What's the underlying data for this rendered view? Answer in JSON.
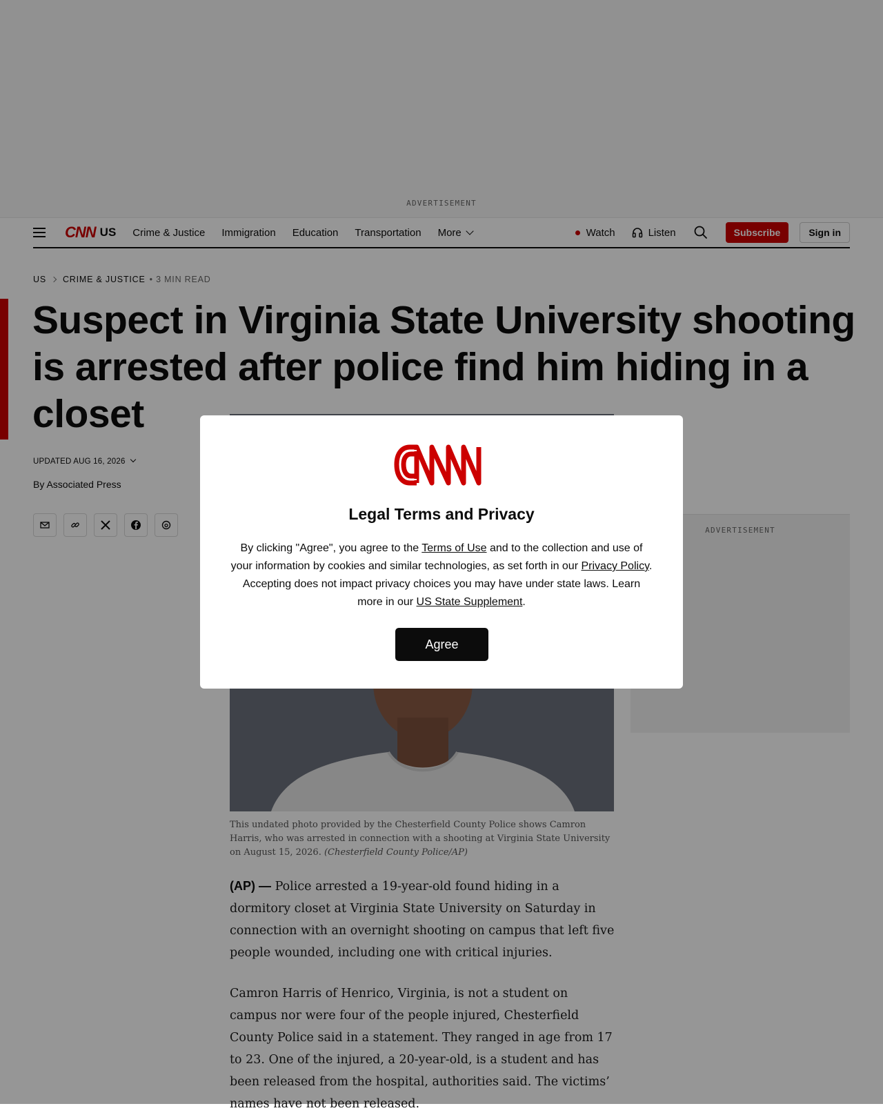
{
  "advertisement": {
    "top_label": "ADVERTISEMENT",
    "side_label": "ADVERTISEMENT"
  },
  "nav": {
    "logo": "CNN",
    "edition": "US",
    "items": [
      "Crime & Justice",
      "Immigration",
      "Education",
      "Transportation",
      "More"
    ],
    "watch": "Watch",
    "listen": "Listen",
    "subscribe": "Subscribe",
    "signin": "Sign in"
  },
  "breadcrumb": {
    "section": "US",
    "subsection": "CRIME & JUSTICE",
    "read_time": "• 3 MIN READ"
  },
  "article": {
    "headline": "Suspect in Virginia State University shooting is arrested after police find him hiding in a closet",
    "updated": "UPDATED AUG 16, 2026",
    "byline": "By Associated Press",
    "caption_text": "This undated photo provided by the Chesterfield County Police shows Camron Harris, who was arrested in connection with a shooting at Virginia State University on August 15, 2026.",
    "caption_credit": "(Chesterfield County Police/AP)",
    "dateline": "(AP) —",
    "p1": "Police arrested a 19-year-old found hiding in a dormitory closet at Virginia State University on Saturday in connection with an overnight shooting on campus that left five people wounded, including one with critical injuries.",
    "p2": "Camron Harris of Henrico, Virginia, is not a student on campus nor were four of the people injured, Chesterfield County Police said in a statement. They ranged in age from 17 to 23. One of the injured, a 20-year-old, is a student and has been released from the hospital, authorities said. The victims’ names have not been released."
  },
  "share": {
    "icons": [
      "email-icon",
      "link-icon",
      "x-icon",
      "facebook-icon",
      "threads-icon"
    ]
  },
  "modal": {
    "logo": "CNN",
    "title": "Legal Terms and Privacy",
    "text_1": "By clicking \"Agree\", you agree to the ",
    "link_terms": "Terms of Use",
    "text_2": " and to the collection and use of your information by cookies and similar technologies, as set forth in our ",
    "link_privacy": "Privacy Policy",
    "text_3": ". Accepting does not impact privacy choices you may have under state laws. Learn more in our ",
    "link_supplement": "US State Supplement",
    "text_4": ".",
    "agree_button": "Agree"
  },
  "colors": {
    "brand_red": "#cc0000",
    "overlay": "rgba(0,0,0,0.41)",
    "button_dark": "#0c0c0c"
  }
}
